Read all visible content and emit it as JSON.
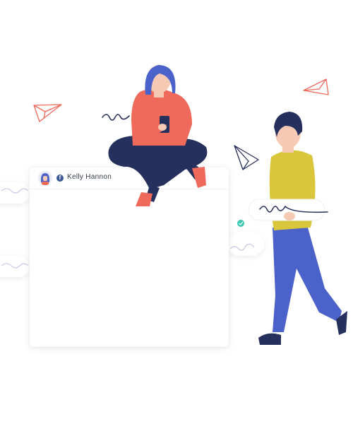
{
  "post": {
    "author_name": "Kelly Hannon",
    "network_icon": "facebook-icon",
    "network_glyph": "f"
  },
  "colors": {
    "accent_red": "#ef6a5a",
    "indigo": "#26305c",
    "blue": "#4a62c9",
    "mustard": "#d9c63a",
    "facebook": "#3b5998",
    "check_green": "#3ec9b0"
  }
}
